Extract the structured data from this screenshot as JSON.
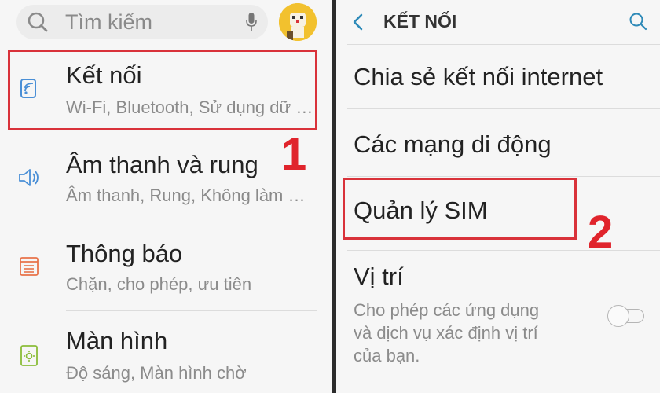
{
  "left": {
    "search": {
      "placeholder": "Tìm kiếm"
    },
    "items": [
      {
        "title": "Kết nối",
        "subtitle": "Wi-Fi, Bluetooth, Sử dụng dữ liệu",
        "icon": "connection-icon"
      },
      {
        "title": "Âm thanh và rung",
        "subtitle": "Âm thanh, Rung, Không làm phiền",
        "icon": "speaker-icon"
      },
      {
        "title": "Thông báo",
        "subtitle": "Chặn, cho phép, ưu tiên",
        "icon": "notification-icon"
      },
      {
        "title": "Màn hình",
        "subtitle": "Độ sáng, Màn hình chờ",
        "icon": "display-icon"
      }
    ],
    "step": "1"
  },
  "right": {
    "title": "KẾT NỐI",
    "items": [
      {
        "title": "Chia sẻ kết nối internet"
      },
      {
        "title": "Các mạng di động"
      },
      {
        "title": "Quản lý SIM"
      },
      {
        "title": "Vị trí",
        "description": "Cho phép các ứng dụng và dịch vụ xác định vị trí của bạn."
      }
    ],
    "step": "2",
    "location_toggle_on": false
  },
  "colors": {
    "highlight": "#d9323a",
    "step_number": "#e0242c",
    "icon_blue": "#4a8fd6",
    "icon_orange": "#e8734a",
    "icon_green": "#8bbd3a"
  }
}
